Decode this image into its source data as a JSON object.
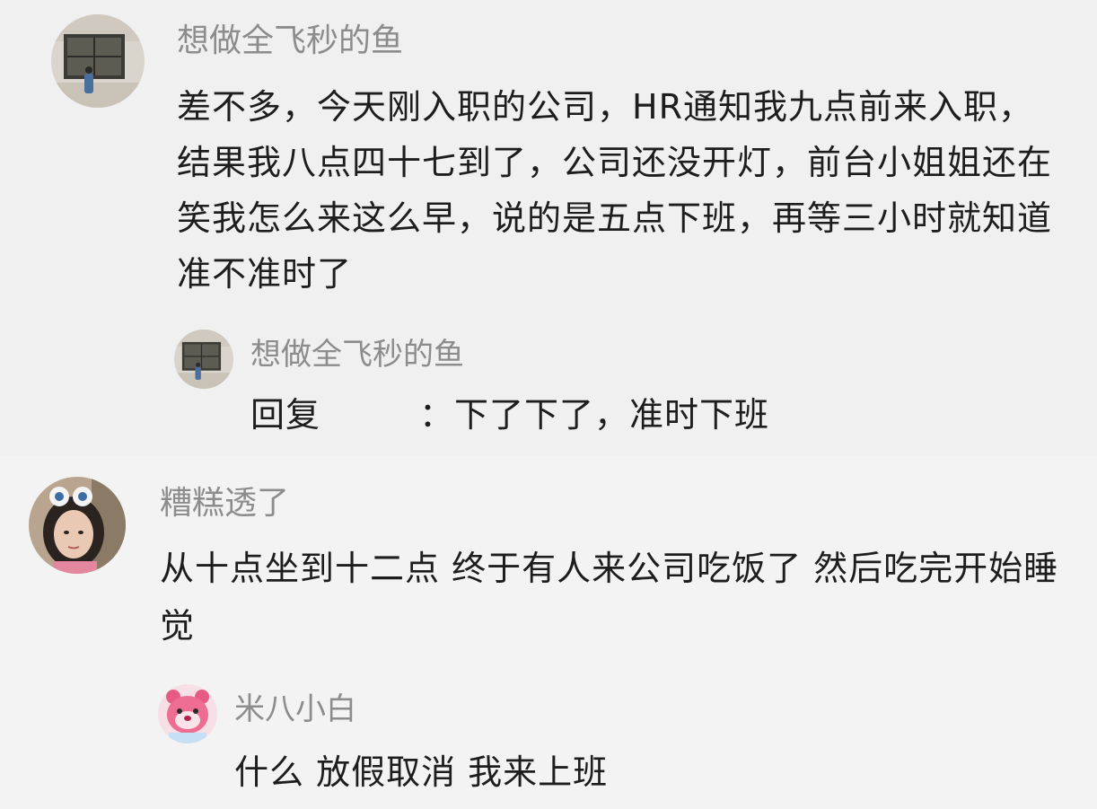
{
  "comments": [
    {
      "username": "想做全飞秒的鱼",
      "avatar_icon": "window-photo-avatar",
      "text": "差不多，今天刚入职的公司，HR通知我九点前来入职，结果我八点四十七到了，公司还没开灯，前台小姐姐还在笑我怎么来这么早，说的是五点下班，再等三小时就知道准不准时了",
      "reply": {
        "username": "想做全飞秒的鱼",
        "avatar_icon": "window-photo-avatar",
        "prefix": "回复",
        "text": "：下了下了，准时下班"
      }
    },
    {
      "username": "糟糕透了",
      "avatar_icon": "girl-portrait-avatar",
      "text": "从十点坐到十二点 终于有人来公司吃饭了 然后吃完开始睡觉",
      "reply": {
        "username": "米八小白",
        "avatar_icon": "pink-bear-avatar",
        "text": "什么 放假取消 我来上班"
      }
    }
  ]
}
